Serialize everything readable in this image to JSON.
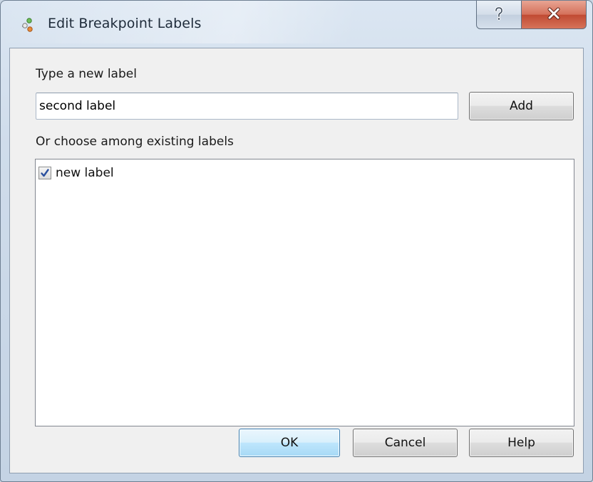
{
  "window": {
    "title": "Edit Breakpoint Labels",
    "icon": "breakpoint-labels-icon",
    "controls": {
      "help_glyph": "?",
      "close_glyph": "X"
    }
  },
  "new_label": {
    "heading": "Type a new label",
    "value": "second label",
    "add_button": "Add"
  },
  "existing_labels": {
    "heading": "Or choose among existing labels",
    "items": [
      {
        "label": "new label",
        "checked": true
      }
    ]
  },
  "footer": {
    "ok_button": "OK",
    "cancel_button": "Cancel",
    "help_button": "Help"
  },
  "colors": {
    "close_button": "#c9543c",
    "default_button_border": "#3c7fb1",
    "checkmark": "#2a4f9e"
  }
}
